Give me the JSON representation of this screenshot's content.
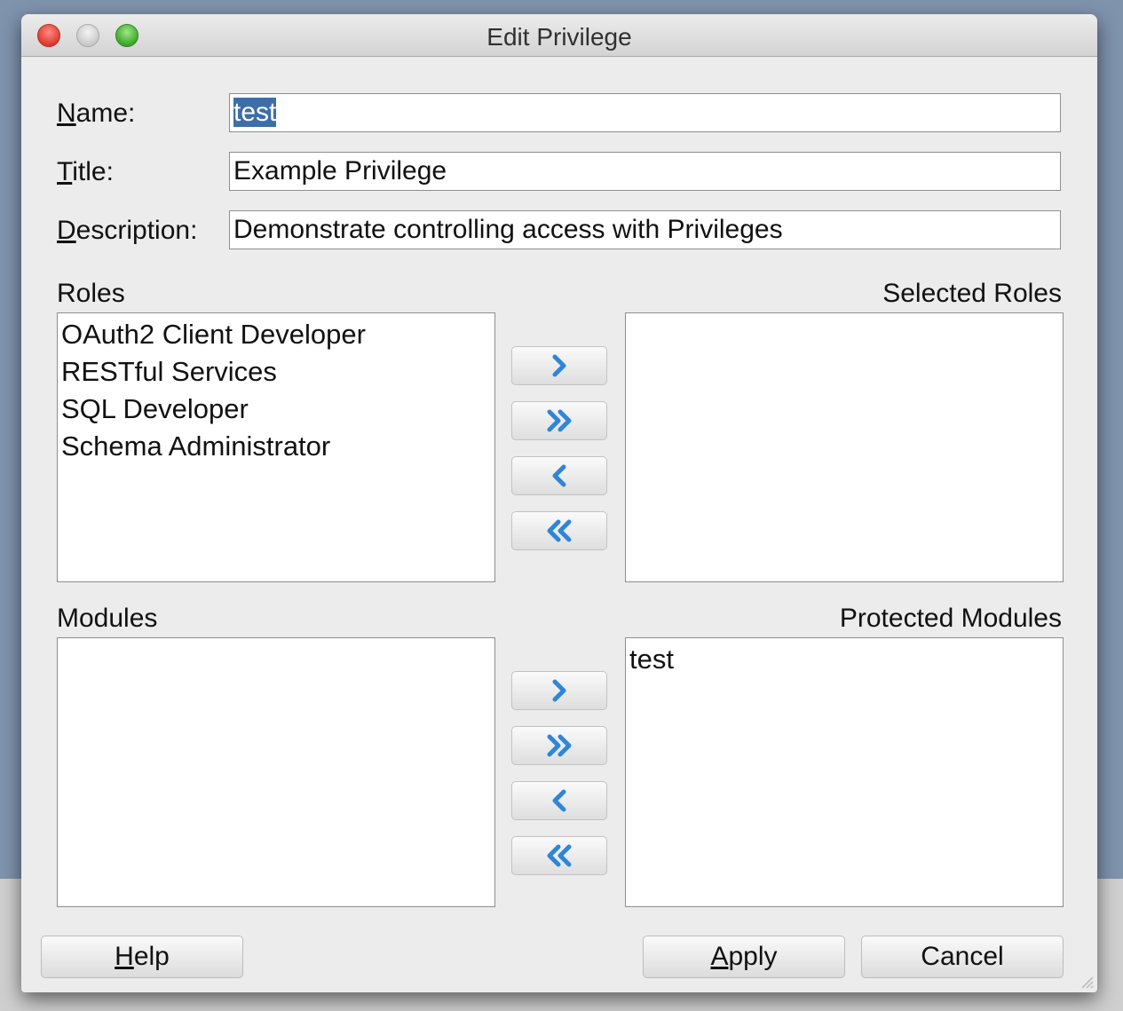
{
  "dialog": {
    "title": "Edit Privilege"
  },
  "form": {
    "name_label": {
      "mnemonic": "N",
      "rest": "ame:"
    },
    "name_value": "test",
    "title_label": {
      "mnemonic": "T",
      "rest": "itle:"
    },
    "title_value": "Example Privilege",
    "description_label": {
      "mnemonic": "D",
      "rest": "escription:"
    },
    "description_value": "Demonstrate controlling access with Privileges"
  },
  "roles": {
    "available_label": "Roles",
    "selected_label": "Selected Roles",
    "available": [
      "OAuth2 Client Developer",
      "RESTful Services",
      "SQL Developer",
      "Schema Administrator"
    ],
    "selected": []
  },
  "modules": {
    "available_label": "Modules",
    "selected_label": "Protected Modules",
    "available": [],
    "selected": [
      "test"
    ]
  },
  "buttons": {
    "help": {
      "mnemonic": "H",
      "rest": "elp"
    },
    "apply": {
      "mnemonic": "A",
      "rest": "pply"
    },
    "cancel": "Cancel"
  },
  "icons": {
    "move_right": "chevron-right-icon",
    "move_all_right": "double-chevron-right-icon",
    "move_left": "chevron-left-icon",
    "move_all_left": "double-chevron-left-icon"
  },
  "colors": {
    "selection": "#3d6ea8",
    "arrow": "#2f86d6"
  }
}
